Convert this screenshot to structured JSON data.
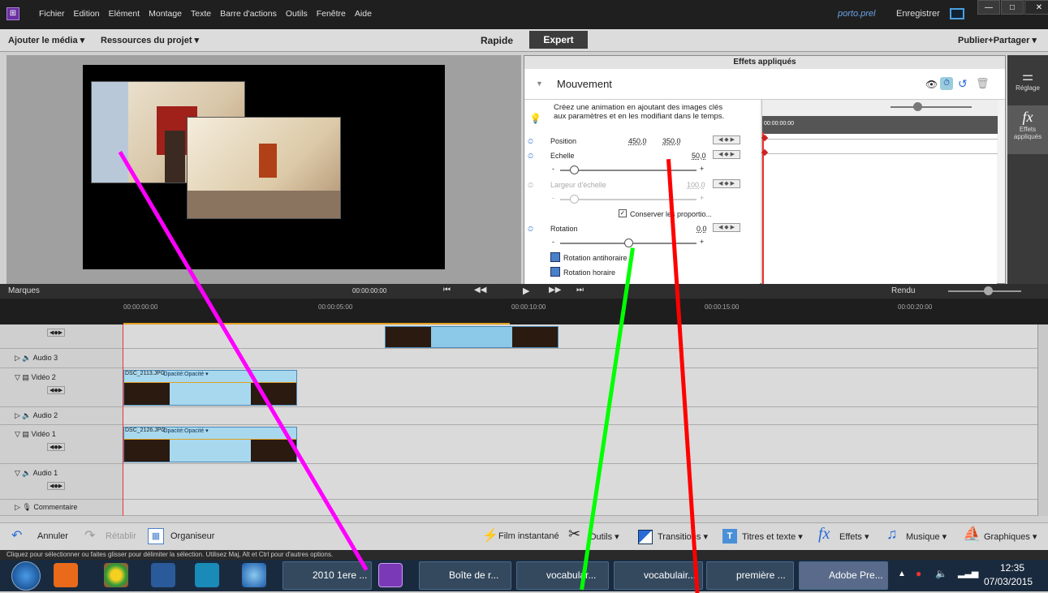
{
  "titlebar": {
    "app_icon": "premiere-elements-icon",
    "menu": [
      "Fichier",
      "Edition",
      "Elément",
      "Montage",
      "Texte",
      "Barre d'actions",
      "Outils",
      "Fenêtre",
      "Aide"
    ],
    "project_name": "porto.prel",
    "save_label": "Enregistrer"
  },
  "toolbar": {
    "add_media": "Ajouter le média ▾",
    "project_assets": "Ressources du projet ▾",
    "quick": "Rapide",
    "expert": "Expert",
    "publish": "Publier+Partager ▾"
  },
  "effects": {
    "header": "Effets appliqués",
    "section": "Mouvement",
    "hint": "Créez une animation en ajoutant des images clés aux paramètres et en les modifiant dans le temps.",
    "kf_timecode": "00:00:00:00",
    "position_label": "Position",
    "position_x": "450,0",
    "position_y": "350,0",
    "scale_label": "Echelle",
    "scale_value": "50,0",
    "scale_level": 0.1,
    "scale_width_label": "Largeur d'échelle",
    "scale_width_value": "100,0",
    "keep_proportions": "Conserver les proportio...",
    "rotation_label": "Rotation",
    "rotation_value": "0,0",
    "rotation_level": 0.5,
    "rotate_ccw": "Rotation antihoraire",
    "rotate_cw": "Rotation horaire"
  },
  "side": {
    "adjust": "Réglage",
    "applied_effects": "Effets appliqués"
  },
  "transport": {
    "markers": "Marques",
    "timecode": "00:00:00:00",
    "render": "Rendu"
  },
  "ruler": {
    "ticks": [
      "00:00:00:00",
      "00:00:05:00",
      "00:00:10:00",
      "00:00:15:00",
      "00:00:20:00"
    ]
  },
  "tracks": {
    "audio3": "Audio 3",
    "video2": "Vidéo 2",
    "audio2": "Audio 2",
    "video1": "Vidéo 1",
    "audio1": "Audio 1",
    "comment": "Commentaire",
    "clip_v2": "DSC_2113.JPG",
    "clip_v2_fx": "Opacité:Opacité ▾",
    "clip_v1": "DSC_2126.JPG",
    "clip_v1_fx": "Opacité:Opacité ▾"
  },
  "bottombar": {
    "undo": "Annuler",
    "redo": "Rétablir",
    "organizer": "Organiseur",
    "instant_movie": "Film instantané",
    "tools": "Outils ▾",
    "transitions": "Transitions ▾",
    "titles": "Titres et texte ▾",
    "effects": "Effets ▾",
    "music": "Musique ▾",
    "graphics": "Graphiques ▾"
  },
  "status": "Cliquez pour sélectionner ou faites glisser pour délimiter la sélection. Utilisez Maj, Alt et Ctrl pour d'autres options.",
  "taskbar": {
    "apps": [
      "2010 1ere ...",
      "Boîte de r...",
      "vocabular...",
      "vocabulair...",
      "première ...",
      "Adobe Pre..."
    ],
    "time": "12:35",
    "date": "07/03/2015"
  },
  "colors": {
    "magenta_line": "#ff00ff",
    "green_line": "#00ff00",
    "red_line": "#ff0000"
  }
}
